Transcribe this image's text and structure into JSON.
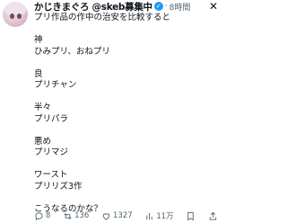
{
  "post": {
    "author_name": "かじきまぐろ @skeb募集中",
    "verified_mark": "✓",
    "separator": "·",
    "time": "8時間",
    "lines": [
      "プリ作品の作中の治安を比較すると",
      "",
      "神",
      "ひみプリ、おねプリ",
      "",
      "良",
      "プリチャン",
      "",
      "半々",
      "プリパラ",
      "",
      "悪め",
      "プリマジ",
      "",
      "ワースト",
      "プリリズ3作",
      "",
      "こうなるのかな？"
    ]
  },
  "actions": {
    "replies": "8",
    "reposts": "136",
    "likes": "1327",
    "views": "11万"
  },
  "colors": {
    "text": "#0f1419",
    "muted": "#536471",
    "verified": "#1d9bf0"
  },
  "icons": [
    "avatar",
    "verified-badge-icon",
    "close-icon",
    "reply-icon",
    "repost-icon",
    "like-icon",
    "views-icon",
    "bookmark-icon",
    "share-icon"
  ]
}
